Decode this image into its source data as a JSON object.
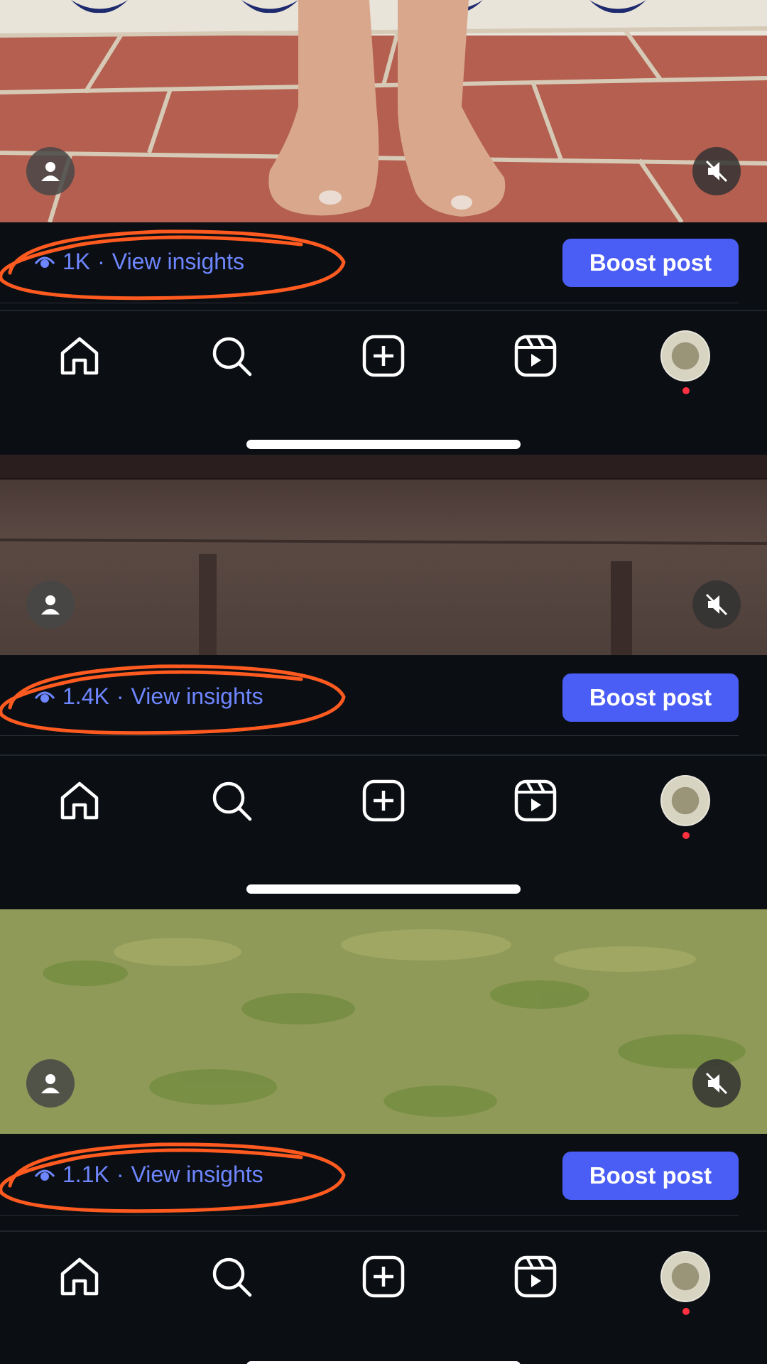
{
  "posts": [
    {
      "views": "1K",
      "insights_label": "View insights",
      "separator": "·",
      "boost_label": "Boost post",
      "media": "bare feet on red brick patio"
    },
    {
      "views": "1.4K",
      "insights_label": "View insights",
      "separator": "·",
      "boost_label": "Boost post",
      "media": "dark wooden surface"
    },
    {
      "views": "1.1K",
      "insights_label": "View insights",
      "separator": "·",
      "boost_label": "Boost post",
      "media": "green grass lawn"
    }
  ],
  "icons": {
    "avatar": "person-icon",
    "mute": "muted-speaker-icon",
    "views": "eye-icon",
    "tabs": [
      "home-icon",
      "search-icon",
      "create-icon",
      "reels-icon",
      "profile-avatar"
    ]
  },
  "colors": {
    "background": "#0b0f14",
    "insights_text": "#6e86ff",
    "boost_button": "#4a5df4",
    "annotation": "#ff5a1f",
    "notification_dot": "#ff3040"
  }
}
